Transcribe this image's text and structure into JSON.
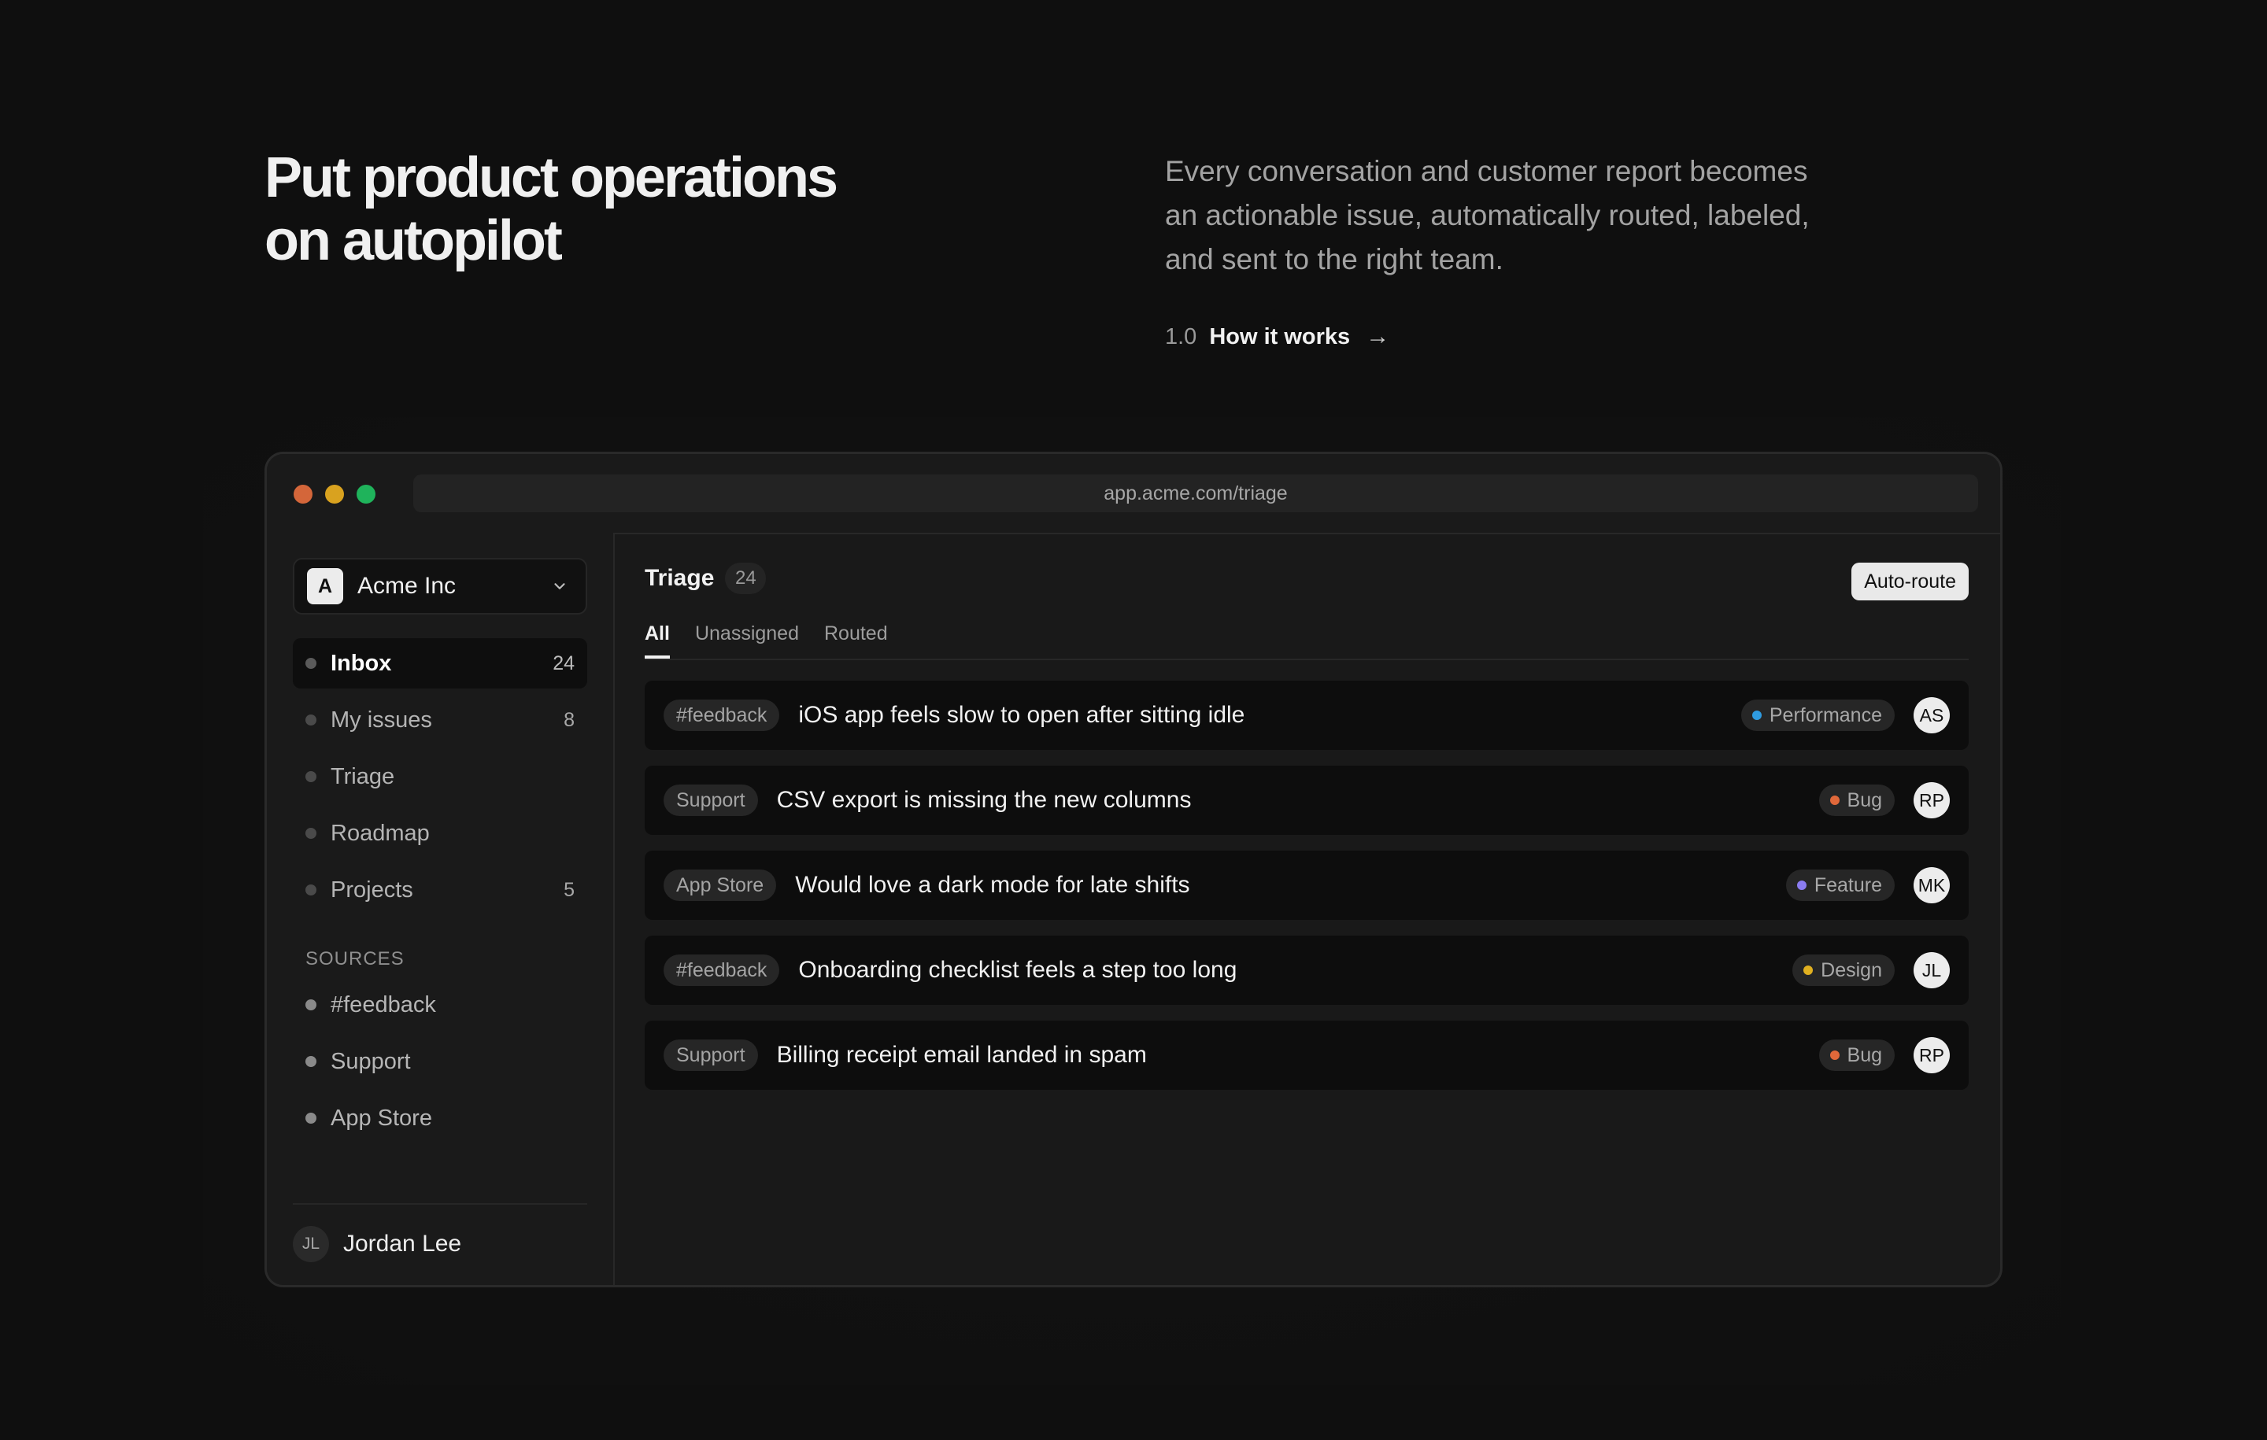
{
  "hero": {
    "title_line1": "Put product operations",
    "title_line2": "on autopilot",
    "description": "Every conversation and customer report becomes an actionable issue, automatically routed, labeled, and sent to the right team.",
    "link_number": "1.0",
    "link_label": "How it works",
    "link_icon": "arrow-right-icon"
  },
  "browser": {
    "url": "app.acme.com/triage",
    "traffic_light_colors": [
      "#d4663a",
      "#d9a21f",
      "#1fb35b"
    ]
  },
  "sidebar": {
    "workspace_initial": "A",
    "workspace_name": "Acme Inc",
    "items": [
      {
        "label": "Inbox",
        "count": "24",
        "active": true
      },
      {
        "label": "My issues",
        "count": "8"
      },
      {
        "label": "Triage",
        "count": ""
      },
      {
        "label": "Roadmap",
        "count": ""
      },
      {
        "label": "Projects",
        "count": "5"
      }
    ],
    "sources_title": "SOURCES",
    "sources": [
      {
        "label": "#feedback"
      },
      {
        "label": "Support"
      },
      {
        "label": "App Store"
      }
    ],
    "user_initials": "JL",
    "user_name": "Jordan Lee"
  },
  "main": {
    "title": "Triage",
    "count": "24",
    "auto_route_label": "Auto-route",
    "tabs": [
      {
        "label": "All",
        "active": true
      },
      {
        "label": "Unassigned"
      },
      {
        "label": "Routed"
      }
    ],
    "issues": [
      {
        "source": "#feedback",
        "title": "iOS app feels slow to open after sitting idle",
        "label": "Performance",
        "label_color": "#2f9be0",
        "assignee": "AS"
      },
      {
        "source": "Support",
        "title": "CSV export is missing the new columns",
        "label": "Bug",
        "label_color": "#e0683a",
        "assignee": "RP"
      },
      {
        "source": "App Store",
        "title": "Would love a dark mode for late shifts",
        "label": "Feature",
        "label_color": "#8b7cf0",
        "assignee": "MK"
      },
      {
        "source": "#feedback",
        "title": "Onboarding checklist feels a step too long",
        "label": "Design",
        "label_color": "#e0b020",
        "assignee": "JL"
      },
      {
        "source": "Support",
        "title": "Billing receipt email landed in spam",
        "label": "Bug",
        "label_color": "#e0683a",
        "assignee": "RP"
      }
    ]
  }
}
